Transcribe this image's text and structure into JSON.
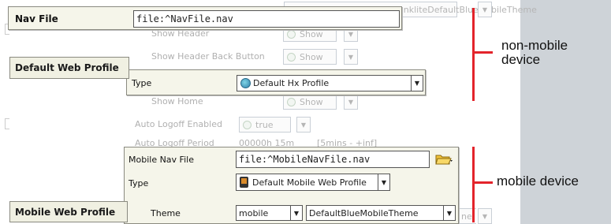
{
  "background": {
    "rows": [
      {
        "label": "Show Header",
        "value": "Show"
      },
      {
        "label": "Show Header Back Button",
        "value": "Show"
      },
      {
        "label": "Show Home",
        "value": "Show"
      },
      {
        "label": "Auto Logoff Enabled",
        "value": "true"
      },
      {
        "label": "Auto Logoff Period",
        "value": "00000h 15m",
        "suffix": "[5mins - +inf]"
      }
    ],
    "top_theme_text": "ankliteDefaultBlueMobileTheme",
    "bottom_theme_text": "ne"
  },
  "nav_file": {
    "label": "Nav File",
    "value": "file:^NavFile.nav"
  },
  "default_web_profile": {
    "label": "Default Web Profile",
    "type_label": "Type",
    "type_value": "Default Hx Profile"
  },
  "mobile_web_profile": {
    "label": "Mobile Web Profile",
    "nav_file_label": "Mobile Nav File",
    "nav_file_value": "file:^MobileNavFile.nav",
    "type_label": "Type",
    "type_value": "Default Mobile Web Profile",
    "theme_label": "Theme",
    "theme_value": "mobile",
    "theme_name_value": "DefaultBlueMobileTheme"
  },
  "annotations": {
    "non_mobile_line1": "non-mobile",
    "non_mobile_line2": "device",
    "mobile": "mobile device"
  },
  "colors": {
    "annotation_line": "#e3242b",
    "panel_bg": "#f5f5ea",
    "side_panel": "#ced3d8"
  }
}
